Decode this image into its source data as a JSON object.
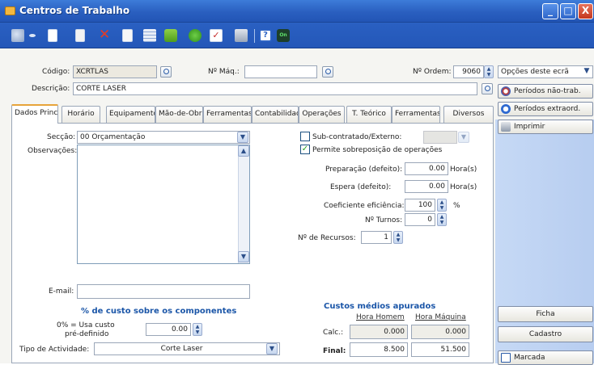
{
  "window": {
    "title": "Centros de Trabalho",
    "controls": [
      "_",
      "□",
      "X"
    ]
  },
  "toolbar": {
    "icons": [
      "tools-icon",
      "dropdown-arrow-icon",
      "new-document-icon",
      "copy-document-icon",
      "delete-icon",
      "edit-icon",
      "table-icon",
      "folder-icon",
      "refresh-icon",
      "check-icon",
      "print-icon",
      "help-icon",
      "on-icon"
    ]
  },
  "header": {
    "codigo_label": "Código:",
    "codigo_value": "XCRTLAS",
    "nmaq_label": "Nº Máq.:",
    "nmaq_value": "",
    "nordem_label": "Nº Ordem:",
    "nordem_value": "9060",
    "descricao_label": "Descrição:",
    "descricao_value": "CORTE LASER",
    "opcoes_select": "Opções deste ecrã"
  },
  "tabs": [
    {
      "label": "Dados Princi",
      "active": true
    },
    {
      "label": "Horário",
      "active": false
    },
    {
      "label": "Equipamento",
      "active": false
    },
    {
      "label": "Mão-de-Obr",
      "active": false
    },
    {
      "label": "Ferramentas",
      "active": false
    },
    {
      "label": "Contabilidad",
      "active": false
    },
    {
      "label": "Operações",
      "active": false
    },
    {
      "label": "T. Teórico",
      "active": false
    },
    {
      "label": "Ferramentas",
      "active": false
    },
    {
      "label": "Diversos",
      "active": false
    }
  ],
  "form": {
    "seccao_label": "Secção:",
    "seccao_value": "00 Orçamentação",
    "observacoes_label": "Observações:",
    "observacoes_value": "",
    "email_label": "E-mail:",
    "email_value": "",
    "subcontratado_label": "Sub-contratado/Externo:",
    "subcontratado_checked": false,
    "sobreposicao_label": "Permite sobreposição de operações",
    "sobreposicao_checked": true,
    "preparacao_label": "Preparação (defeito):",
    "preparacao_value": "0.00",
    "preparacao_unit": "Hora(s)",
    "espera_label": "Espera (defeito):",
    "espera_value": "0.00",
    "espera_unit": "Hora(s)",
    "coeficiente_label": "Coeficiente eficiência:",
    "coeficiente_value": "100",
    "coeficiente_unit": "%",
    "turnos_label": "Nº Turnos:",
    "turnos_value": "0",
    "recursos_label": "Nº de Recursos:",
    "recursos_value": "1"
  },
  "custo": {
    "heading": "% de custo sobre os componentes",
    "usa_custo_label_1": "0% = Usa custo",
    "usa_custo_label_2": "pré-definido",
    "usa_custo_value": "0.00",
    "tipo_label": "Tipo de Actividade:",
    "tipo_value": "Corte Laser"
  },
  "custos_medios": {
    "heading": "Custos médios apurados",
    "col_hora_homem": "Hora Homem",
    "col_hora_maquina": "Hora Máquina",
    "calc_label": "Calc.:",
    "calc_homem": "0.000",
    "calc_maquina": "0.000",
    "final_label": "Final:",
    "final_homem": "8.500",
    "final_maquina": "51.500"
  },
  "sidebar": {
    "periodos_nao_trab": "Períodos não-trab.",
    "periodos_extraord": "Períodos extraord.",
    "imprimir": "Imprimir",
    "ficha": "Ficha",
    "cadastro": "Cadastro",
    "marcada": "Marcada"
  }
}
